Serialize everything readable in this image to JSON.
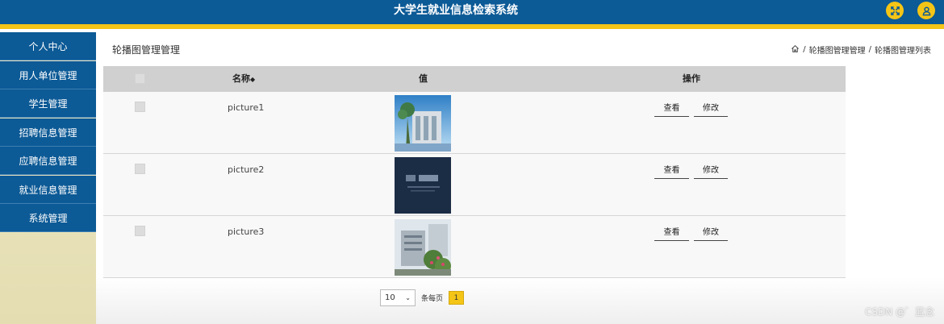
{
  "header": {
    "title": "大学生就业信息检索系统",
    "icons": [
      "fullscreen-icon",
      "user-icon"
    ],
    "accent_color": "#f4c516",
    "brand_color": "#0c5a96"
  },
  "sidebar": {
    "items": [
      {
        "label": "个人中心"
      },
      {
        "label": "用人单位管理"
      },
      {
        "label": "学生管理"
      },
      {
        "label": "招聘信息管理"
      },
      {
        "label": "应聘信息管理"
      },
      {
        "label": "就业信息管理"
      },
      {
        "label": "系统管理"
      }
    ]
  },
  "page": {
    "title": "轮播图管理管理",
    "breadcrumb": [
      "轮播图管理管理",
      "轮播图管理列表"
    ],
    "breadcrumb_sep": "/"
  },
  "table": {
    "columns": {
      "name": "名称",
      "value": "值",
      "actions": "操作"
    },
    "rows": [
      {
        "name": "picture1",
        "view": "查看",
        "edit": "修改",
        "image": "campus-building"
      },
      {
        "name": "picture2",
        "view": "查看",
        "edit": "修改",
        "image": "dark-banner"
      },
      {
        "name": "picture3",
        "view": "查看",
        "edit": "修改",
        "image": "building-with-flowers"
      }
    ]
  },
  "pagination": {
    "page_size": "10",
    "per_page_label": "条每页",
    "current_page": "1"
  },
  "watermark": "CSDN @゛蓝念"
}
